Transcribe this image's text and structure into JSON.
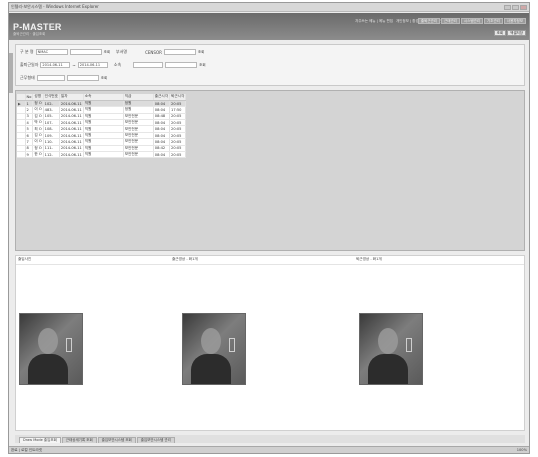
{
  "window": {
    "title": "인텔리-보안시스템 - Windows Internet Explorer"
  },
  "header": {
    "brand": "P-MASTER",
    "subtitle": "출퇴근관리 · 출입조회",
    "toplinks": [
      "자주쓰는 메뉴 | 메뉴 편집",
      "개인정보 | 환경설정",
      "로그아웃"
    ],
    "menu": [
      "출퇴근관리",
      "근태관리",
      "시스템관리",
      "기초관리",
      "사용자정보"
    ],
    "buttons": [
      "조회",
      "엑셀저장"
    ]
  },
  "search": {
    "row1": {
      "label1": "구 분 명",
      "value1": "NMAC",
      "btn1": "조회",
      "label2": "부서명",
      "label3": "CENSOR",
      "btn3": "조회"
    },
    "row2": {
      "label1": "출퇴근일자",
      "from": "2014-06-11",
      "to": "2014-06-11",
      "label2": "소속",
      "btn2": "조회"
    },
    "row3": {
      "label1": "근무형태",
      "btn1": "조회"
    }
  },
  "grid": {
    "columns": [
      "No",
      "성명",
      "인식번호",
      "일자",
      "소속",
      "직급",
      "출근시각",
      "퇴근시각"
    ],
    "rows": [
      {
        "no": "1",
        "name": "정 O",
        "id": "102-",
        "date": "2014-06-11",
        "dept": "직원",
        "rank": "정원",
        "in": "08:04",
        "out": "20:05"
      },
      {
        "no": "2",
        "name": "이 O",
        "id": "483-",
        "date": "2014-06-11",
        "dept": "직원",
        "rank": "정원",
        "in": "08:04",
        "out": "17:50"
      },
      {
        "no": "3",
        "name": "김 O",
        "id": "105-",
        "date": "2014-06-11",
        "dept": "직원",
        "rank": "보안전문",
        "in": "08:48",
        "out": "20:05"
      },
      {
        "no": "4",
        "name": "박 O",
        "id": "107-",
        "date": "2014-06-11",
        "dept": "직원",
        "rank": "보안전문",
        "in": "08:04",
        "out": "20:05"
      },
      {
        "no": "5",
        "name": "최 O",
        "id": "108-",
        "date": "2014-06-11",
        "dept": "직원",
        "rank": "보안전문",
        "in": "08:04",
        "out": "20:05"
      },
      {
        "no": "6",
        "name": "김 O",
        "id": "109-",
        "date": "2014-06-11",
        "dept": "직원",
        "rank": "보안전문",
        "in": "08:04",
        "out": "20:05"
      },
      {
        "no": "7",
        "name": "이 O",
        "id": "110-",
        "date": "2014-06-11",
        "dept": "직원",
        "rank": "보안전문",
        "in": "08:04",
        "out": "20:05"
      },
      {
        "no": "8",
        "name": "정 O",
        "id": "111-",
        "date": "2014-06-11",
        "dept": "직원",
        "rank": "보안전문",
        "in": "08:42",
        "out": "20:05"
      },
      {
        "no": "9",
        "name": "한 O",
        "id": "112-",
        "date": "2014-06-11",
        "dept": "직원",
        "rank": "보안전문",
        "in": "08:04",
        "out": "20:05"
      }
    ]
  },
  "photos": {
    "label1": "출입사진",
    "label2": "출근영상 - 화1개",
    "label3": "퇴근영상 - 화1개"
  },
  "tabs": [
    "Draw Mode 출입조회",
    "근태상세기록 조회",
    "출입보안시스템 조회",
    "출입보안시스템 관리"
  ],
  "status": {
    "left": "완료 | 로컬 인트라넷",
    "right": "100%"
  }
}
